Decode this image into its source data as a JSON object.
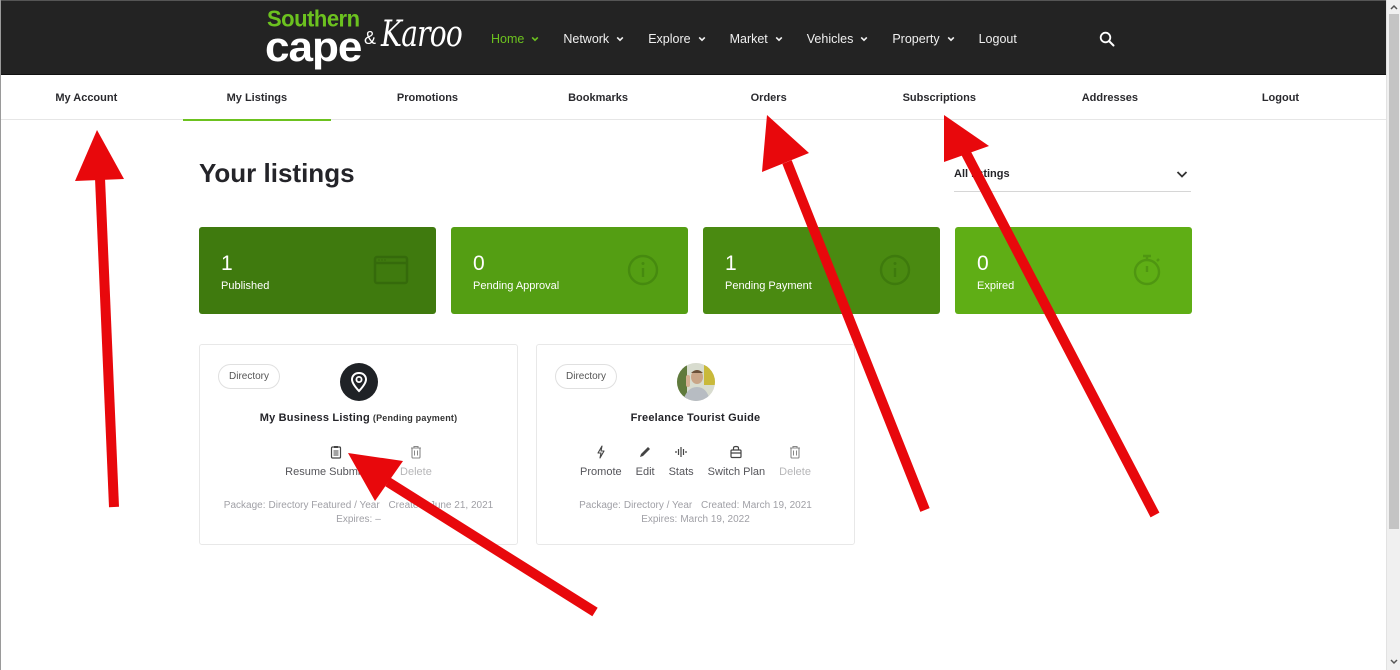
{
  "header": {
    "logo": {
      "line1": "Southern",
      "line2": "cape",
      "ampersand": "&",
      "line3": "Karoo"
    },
    "nav": [
      {
        "label": "Home",
        "has_dropdown": true,
        "active": true
      },
      {
        "label": "Network",
        "has_dropdown": true
      },
      {
        "label": "Explore",
        "has_dropdown": true
      },
      {
        "label": "Market",
        "has_dropdown": true
      },
      {
        "label": "Vehicles",
        "has_dropdown": true
      },
      {
        "label": "Property",
        "has_dropdown": true
      },
      {
        "label": "Logout",
        "has_dropdown": false
      }
    ],
    "search_icon": "search-icon"
  },
  "account_nav": {
    "items": [
      {
        "label": "My Account"
      },
      {
        "label": "My Listings",
        "active": true
      },
      {
        "label": "Promotions"
      },
      {
        "label": "Bookmarks"
      },
      {
        "label": "Orders"
      },
      {
        "label": "Subscriptions"
      },
      {
        "label": "Addresses"
      },
      {
        "label": "Logout"
      }
    ]
  },
  "main": {
    "title": "Your listings",
    "filter": {
      "selected": "All listings"
    },
    "stats": [
      {
        "count": "1",
        "label": "Published",
        "icon": "browser-window-icon",
        "color": "#3f7a0e"
      },
      {
        "count": "0",
        "label": "Pending Approval",
        "icon": "info-circle-icon",
        "color": "#549e13"
      },
      {
        "count": "1",
        "label": "Pending Payment",
        "icon": "info-circle-icon",
        "color": "#4a8a11"
      },
      {
        "count": "0",
        "label": "Expired",
        "icon": "stopwatch-icon",
        "color": "#5fae15"
      }
    ],
    "listings": [
      {
        "category": "Directory",
        "name": "My Business Listing",
        "status": "(Pending payment)",
        "avatar": "map-pin-icon",
        "actions": [
          {
            "label": "Resume Submission",
            "icon": "clipboard-icon"
          },
          {
            "label": "Delete",
            "icon": "trash-icon",
            "disabled": true
          }
        ],
        "package_label": "Package:",
        "package": "Directory Featured / Year",
        "created_label": "Created:",
        "created": "June 21, 2021",
        "expires_label": "Expires:",
        "expires": "–"
      },
      {
        "category": "Directory",
        "name": "Freelance Tourist Guide",
        "status": "",
        "avatar": "user-photo",
        "actions": [
          {
            "label": "Promote",
            "icon": "lightning-icon"
          },
          {
            "label": "Edit",
            "icon": "pencil-icon"
          },
          {
            "label": "Stats",
            "icon": "waveform-icon"
          },
          {
            "label": "Switch Plan",
            "icon": "bag-icon"
          },
          {
            "label": "Delete",
            "icon": "trash-icon",
            "disabled": true
          }
        ],
        "package_label": "Package:",
        "package": "Directory / Year",
        "created_label": "Created:",
        "created": "March 19, 2021",
        "expires_label": "Expires:",
        "expires": "March 19, 2022"
      }
    ]
  },
  "annotations": {
    "arrow_color": "#e8080c",
    "arrows": [
      "points-to-my-account",
      "points-to-orders",
      "points-to-subscriptions",
      "points-to-resume-submission"
    ]
  },
  "colors": {
    "header_bg": "#232323",
    "accent": "#6cc21f"
  }
}
